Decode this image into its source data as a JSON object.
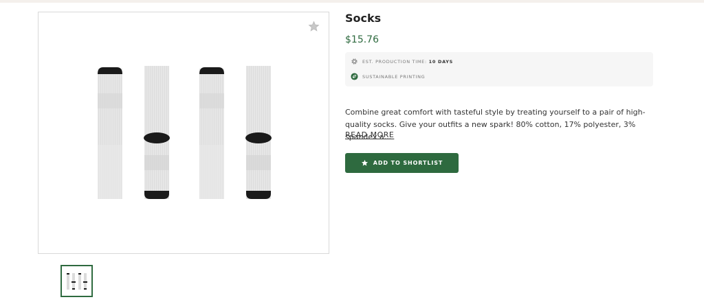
{
  "product": {
    "title": "Socks",
    "price": "$15.76",
    "production_label": "EST. PRODUCTION TIME:",
    "production_value": "10 DAYS",
    "sustainable_label": "SUSTAINABLE PRINTING",
    "description": "Combine great comfort with tasteful style by treating yourself to a pair of high-quality socks. Give your outfits a new spark! 80% cotton, 17% polyester, 3% spandex a...",
    "read_more": "READ MORE",
    "shortlist_label": "ADD TO SHORTLIST"
  },
  "icons": {
    "favorite": "star-icon",
    "production": "gear-icon",
    "sustainable": "leaf-icon",
    "shortlist": "star-icon"
  },
  "colors": {
    "accent": "#2e6a3f",
    "price": "#2e6a3f",
    "meta_background": "#f6f6f6"
  }
}
